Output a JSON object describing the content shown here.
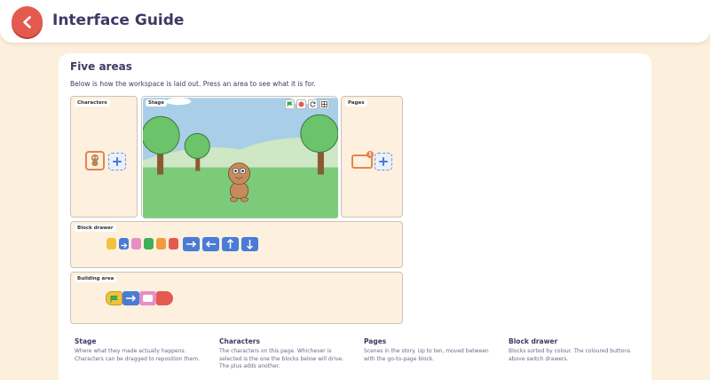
{
  "header": {
    "title": "Interface Guide"
  },
  "card": {
    "title": "Five areas",
    "description": "Below is how the workspace is laid out. Press an area to see what it is for."
  },
  "areas": {
    "characters": "Characters",
    "stage": "Stage",
    "pages": "Pages",
    "block_drawer": "Block drawer",
    "building_area": "Building area"
  },
  "page_badge": "1",
  "colors": {
    "accent": "#e45a4f",
    "title": "#3c3a64",
    "area_bg": "#fdf0de",
    "block_blue": "#4a7bd5",
    "block_yellow": "#f3c23c",
    "block_pink": "#e48fc6",
    "block_green": "#3fae58",
    "block_orange": "#f19b3c",
    "block_red": "#e45a4f"
  },
  "info": [
    {
      "title": "Stage",
      "text": "Where what they made actually happens. Characters can be dragged to reposition them."
    },
    {
      "title": "Characters",
      "text": "The characters on this page. Whichever is selected is the one the blocks below will drive. The plus adds another."
    },
    {
      "title": "Pages",
      "text": "Scenes in the story. Up to ten, moved between with the go-to-page block."
    },
    {
      "title": "Block drawer",
      "text": "Blocks sorted by colour. The coloured buttons above switch drawers."
    }
  ]
}
